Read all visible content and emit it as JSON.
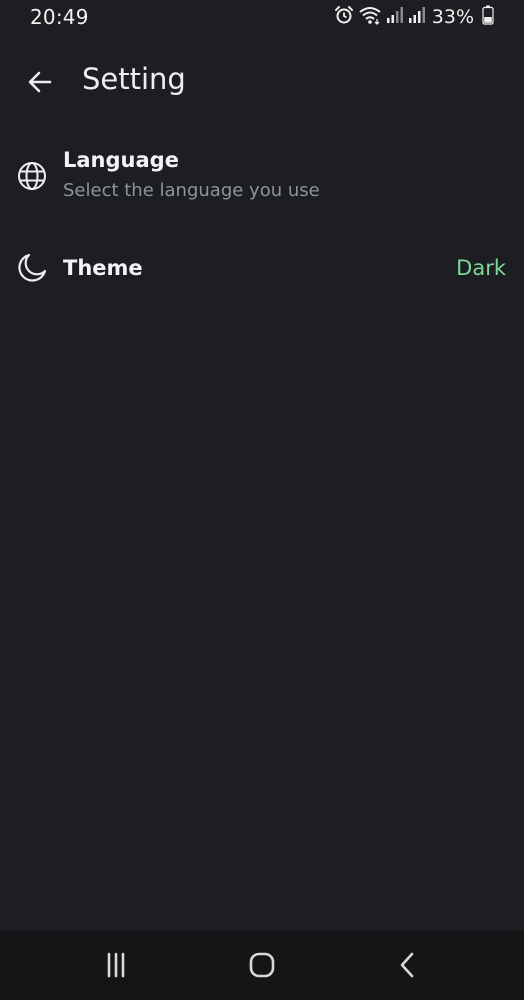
{
  "status_bar": {
    "time": "20:49",
    "battery_percent": "33%",
    "icons": [
      "alarm-icon",
      "wifi-icon",
      "signal-icon",
      "signal-icon",
      "battery-icon"
    ]
  },
  "app_bar": {
    "title": "Setting",
    "back_icon": "arrow-left-icon"
  },
  "settings": {
    "language": {
      "title": "Language",
      "subtitle": "Select the language you use",
      "icon": "globe-icon"
    },
    "theme": {
      "title": "Theme",
      "value": "Dark",
      "icon": "moon-icon"
    }
  },
  "nav_bar": {
    "icons": [
      "recents-icon",
      "home-icon",
      "back-icon"
    ]
  },
  "colors": {
    "background": "#1c1e21",
    "nav_background": "#131517",
    "accent_value": "#7ed699",
    "primary_text": "#f2f3f5",
    "secondary_text": "#8f949a"
  }
}
